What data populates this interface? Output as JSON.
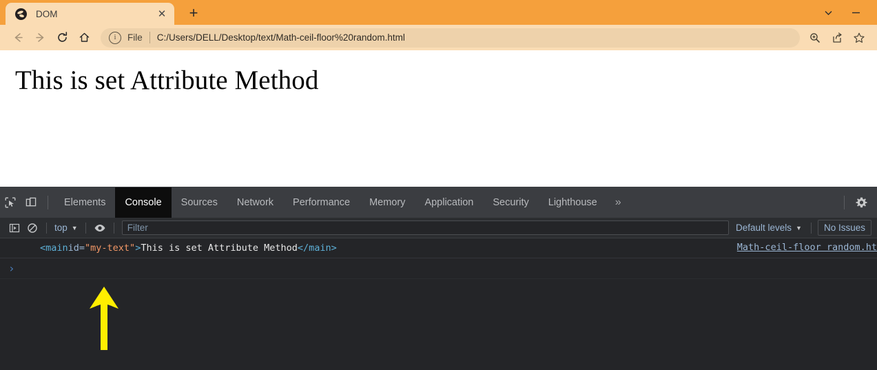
{
  "browser": {
    "tab": {
      "title": "DOM",
      "favicon_name": "globe-favicon",
      "close_label": "✕"
    },
    "new_tab_label": "+",
    "window_controls": {
      "expand_label": "⌄",
      "minimize_label": "—"
    },
    "nav": {
      "back_label": "←",
      "forward_label": "→",
      "reload_label": "↻",
      "home_label": "⌂"
    },
    "omnibox": {
      "info_label": "i",
      "scheme_label": "File",
      "url": "C:/Users/DELL/Desktop/text/Math-ceil-floor%20random.html"
    },
    "toolbar_right": {
      "zoom_label": "zoom-icon",
      "share_label": "share-icon",
      "bookmark_label": "bookmark-star-icon"
    }
  },
  "page": {
    "heading": "This is set Attribute Method"
  },
  "devtools": {
    "inspect_icon": "inspect-element-icon",
    "device_icon": "device-toolbar-icon",
    "tabs": [
      {
        "label": "Elements",
        "active": false
      },
      {
        "label": "Console",
        "active": true
      },
      {
        "label": "Sources",
        "active": false
      },
      {
        "label": "Network",
        "active": false
      },
      {
        "label": "Performance",
        "active": false
      },
      {
        "label": "Memory",
        "active": false
      },
      {
        "label": "Application",
        "active": false
      },
      {
        "label": "Security",
        "active": false
      },
      {
        "label": "Lighthouse",
        "active": false
      }
    ],
    "more_tabs_label": "»",
    "settings_icon": "gear-icon",
    "console_toolbar": {
      "sidebar_toggle_icon": "console-sidebar-icon",
      "clear_icon": "clear-console-icon",
      "context_value": "top",
      "context_caret": "▼",
      "eye_icon": "live-expression-eye-icon",
      "filter_placeholder": "Filter",
      "levels_value": "Default levels",
      "levels_caret": "▼",
      "issues_label": "No Issues"
    },
    "console_output": {
      "tag_open": "<main",
      "attr_name": " id=",
      "attr_value": "\"my-text\"",
      "tag_close_bracket": ">",
      "text_content": "This is set Attribute Method",
      "tag_close": "</main>",
      "source_link": "Math-ceil-floor random.ht"
    },
    "prompt_symbol": "›"
  },
  "annotation": {
    "arrow_name": "yellow-up-arrow-annotation",
    "color": "#ffee00"
  }
}
